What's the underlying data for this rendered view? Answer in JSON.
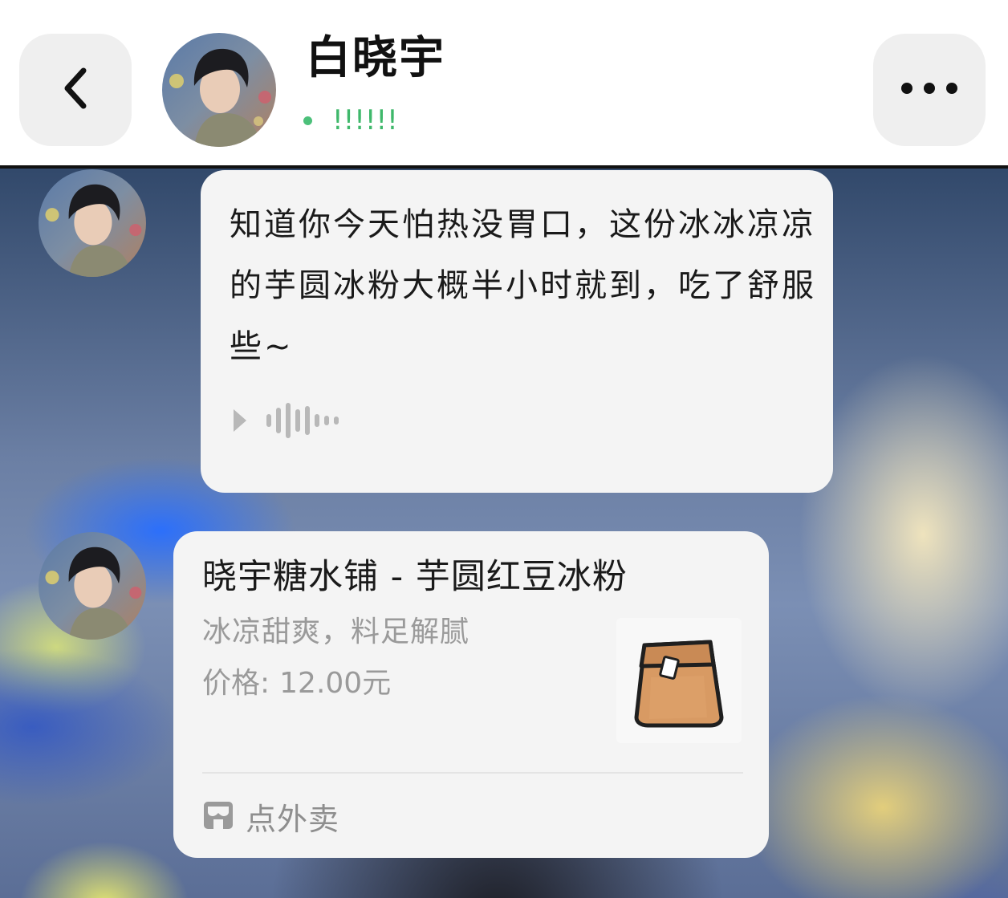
{
  "header": {
    "contact_name": "白晓宇",
    "status_text": "!!!!!!",
    "status_color": "#3fb86b",
    "back_icon": "chevron-left-icon",
    "more_icon": "ellipsis-icon"
  },
  "messages": [
    {
      "type": "text",
      "text": "知道你今天怕热没胃口，这份冰冰凉凉的芋圆冰粉大概半小时就到，吃了舒服些~",
      "voice_icon": "voice-play-icon"
    },
    {
      "type": "takeout_card",
      "title": "晓宇糖水铺 - 芋圆红豆冰粉",
      "description": "冰凉甜爽，料足解腻",
      "price_label": "价格:",
      "price_value": "12.00元",
      "thumbnail_icon": "paper-bag-icon",
      "footer_label": "点外卖",
      "footer_icon": "store-icon"
    }
  ],
  "colors": {
    "bubble_bg": "#f4f4f4",
    "header_button_bg": "#efefef",
    "status_dot": "#4cc07a"
  }
}
